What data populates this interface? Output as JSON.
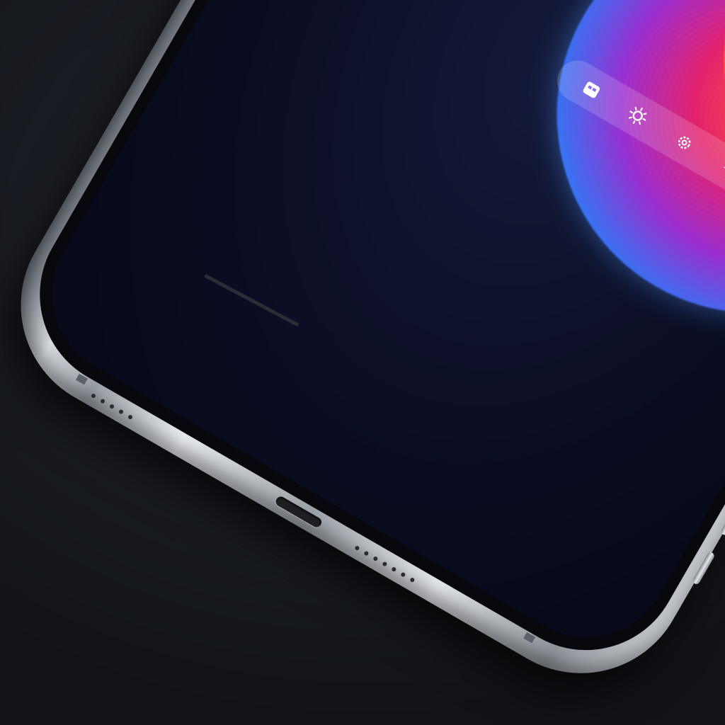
{
  "scene": {
    "description_label": "",
    "background_color": "#15181d"
  },
  "lock_screen": {
    "time_text": "",
    "date_text": "",
    "widget_icons": [
      "calendar-icon",
      "sun-icon",
      "gear-icon",
      "airplane-icon"
    ]
  },
  "colors": {
    "orb_blue": "#4aa6ff",
    "orb_magenta": "#e3226a",
    "orb_orange": "#ff8a3a",
    "frame_silver": "#d9dde2"
  }
}
